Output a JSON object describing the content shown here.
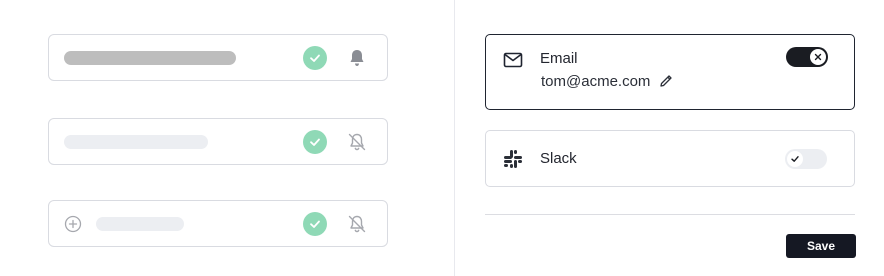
{
  "channels": [
    {
      "label": "Email",
      "value": "tom@acme.com",
      "icon": "mail-icon",
      "enabled": true
    },
    {
      "label": "Slack",
      "icon": "slack-icon",
      "enabled": false
    }
  ],
  "actions": {
    "save_label": "Save"
  },
  "preview_cards": [
    {
      "status": "checked",
      "bell": "bell-filled-icon"
    },
    {
      "status": "checked",
      "bell": "bell-off-icon"
    },
    {
      "status": "checked",
      "bell": "bell-off-icon",
      "leading": "plus-circle-icon"
    }
  ],
  "colors": {
    "accent_check": "#8fd9b6",
    "toggle_on": "#1a1c22",
    "save_bg": "#151823"
  }
}
